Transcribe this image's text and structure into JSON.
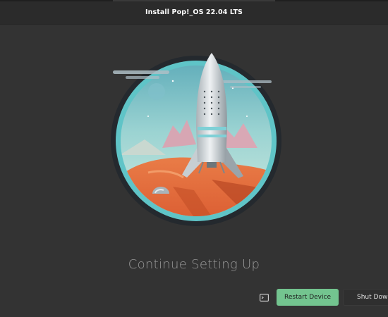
{
  "window": {
    "title": "Install Pop!_OS 22.04 LTS"
  },
  "main": {
    "illustration": "rocket-on-mars-illustration",
    "heading": "Continue Setting Up"
  },
  "footer": {
    "terminal_icon": "terminal-icon",
    "restart_label": "Restart Device",
    "shutdown_label": "Shut Down"
  },
  "colors": {
    "background": "#333333",
    "titlebar": "#2b2b2b",
    "accent_green": "#73c48f",
    "ring_teal": "#5fc4c7"
  }
}
